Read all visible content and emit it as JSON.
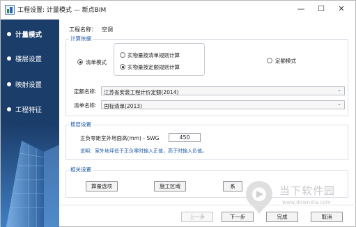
{
  "window": {
    "title": "工程设置: 计量模式 — 新点BIM",
    "minimize_glyph": "—",
    "maximize_glyph": "☐",
    "close_glyph": "✕"
  },
  "sidebar": {
    "items": [
      {
        "label": "计量模式",
        "active": true
      },
      {
        "label": "楼层设置",
        "active": false
      },
      {
        "label": "映射设置",
        "active": false
      },
      {
        "label": "工程特征",
        "active": false
      }
    ]
  },
  "project": {
    "name_label": "工程名称：",
    "name_value": "空调"
  },
  "calc_basis": {
    "title": "计算依据",
    "list_mode_label": "清单模式",
    "list_rule_label": "实物量按清单规则计算",
    "quota_rule_label": "实物量按定额规则计算",
    "quota_mode_label": "定额模式",
    "quota_name_label": "定额名称:",
    "quota_name_value": "江苏省安装工程计价定额(2014)",
    "list_name_label": "清单名称:",
    "list_name_value": "国标清单(2013)"
  },
  "floor_settings": {
    "title": "楼层设置",
    "height_label": "正负零距室外地面高(mm) - SWG",
    "height_value": "450",
    "note": "说明：室外地坪低于正负零时输入正值，高于时输入负值。"
  },
  "related_settings": {
    "title": "相关设置",
    "calc_options_label": "算量选项",
    "construction_zone_label": "施工区域",
    "third_button_label": "系"
  },
  "footer": {
    "prev_label": "上一步",
    "next_label": "下一步",
    "finish_label": "完成",
    "cancel_label": "取消"
  },
  "watermark": {
    "text": "当下软件园",
    "url": "www.downxia.com"
  },
  "colors": {
    "sidebar_bg": "#1b3d6a",
    "accent_blue": "#1e5aa8"
  }
}
